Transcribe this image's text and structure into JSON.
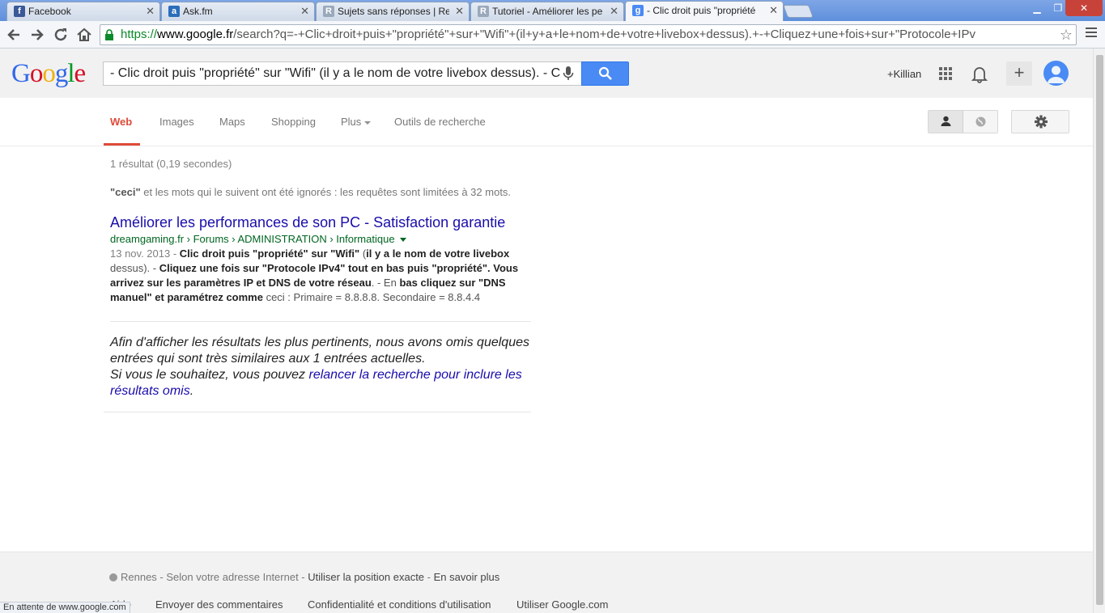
{
  "browser": {
    "tabs": [
      {
        "label": "Facebook",
        "favicon": "f",
        "color": "#3b5998"
      },
      {
        "label": "Ask.fm",
        "favicon": "a",
        "color": "#2a6ebb"
      },
      {
        "label": "Sujets sans réponses | Real",
        "favicon": "R",
        "color": "#9aa8bb"
      },
      {
        "label": "Tutoriel - Améliorer les pe",
        "favicon": "R",
        "color": "#9aa8bb"
      },
      {
        "label": "- Clic droit puis \"propriété",
        "favicon": "g",
        "color": "#4a8af4"
      }
    ],
    "close_glyph": "✕",
    "win_minimize": "▁",
    "win_maximize": "❐",
    "win_close": "✕",
    "url_scheme": "https://",
    "url_host": "www.google.fr",
    "url_rest": "/search?q=-+Clic+droit+puis+\"propriété\"+sur+\"Wifi\"+(il+y+a+le+nom+de+votre+livebox+dessus).+-+Cliquez+une+fois+sur+\"Protocole+IPv",
    "star": "☆",
    "status": "En attente de www.google.com"
  },
  "header": {
    "logo": [
      "G",
      "o",
      "o",
      "g",
      "l",
      "e"
    ],
    "query": "- Clic droit puis \"propriété\" sur \"Wifi\" (il y a le nom de votre livebox dessus). - C",
    "user": "+Killian",
    "plus": "+"
  },
  "nav": {
    "tabs": [
      "Web",
      "Images",
      "Maps",
      "Shopping",
      "Plus",
      "Outils de recherche"
    ]
  },
  "results": {
    "stats": "1 résultat (0,19 secondes)",
    "notice_bold": "\"ceci\"",
    "notice_rest": " et les mots qui le suivent ont été ignorés : les requêtes sont limitées à 32 mots.",
    "items": [
      {
        "title": "Améliorer les performances de son PC - Satisfaction garantie",
        "url": "dreamgaming.fr › Forums › ADMINISTRATION › Informatique",
        "date": "13 nov. 2013 - ",
        "s1": "Clic droit puis \"propriété\" sur \"Wifi\"",
        "s2": " (",
        "s3": "il y a le nom de votre livebox",
        "s4": " dessus). - ",
        "s5": "Cliquez une fois sur \"Protocole IPv4\" tout en bas puis \"propriété\". Vous arrivez sur les paramètres IP et DNS de votre réseau",
        "s6": ". - En ",
        "s7": "bas cliquez sur \"DNS manuel\" et paramétrez comme",
        "s8": " ceci : Primaire = 8.8.8.8. Secondaire = 8.8.4.4"
      }
    ],
    "omitted_1": "Afin d'afficher les résultats les plus pertinents, nous avons omis quelques entrées qui sont très similaires aux 1 entrées actuelles.",
    "omitted_2": "Si vous le souhaitez, vous pouvez ",
    "omitted_link": "relancer la recherche pour inclure les résultats omis",
    "omitted_end": "."
  },
  "footer": {
    "city": "Rennes",
    "sep1": " - Selon votre adresse Internet - ",
    "precise": "Utiliser la position exacte",
    "sep2": " - ",
    "learn": "En savoir plus",
    "links": [
      "Aide",
      "Envoyer des commentaires",
      "Confidentialité et conditions d'utilisation",
      "Utiliser Google.com"
    ]
  }
}
